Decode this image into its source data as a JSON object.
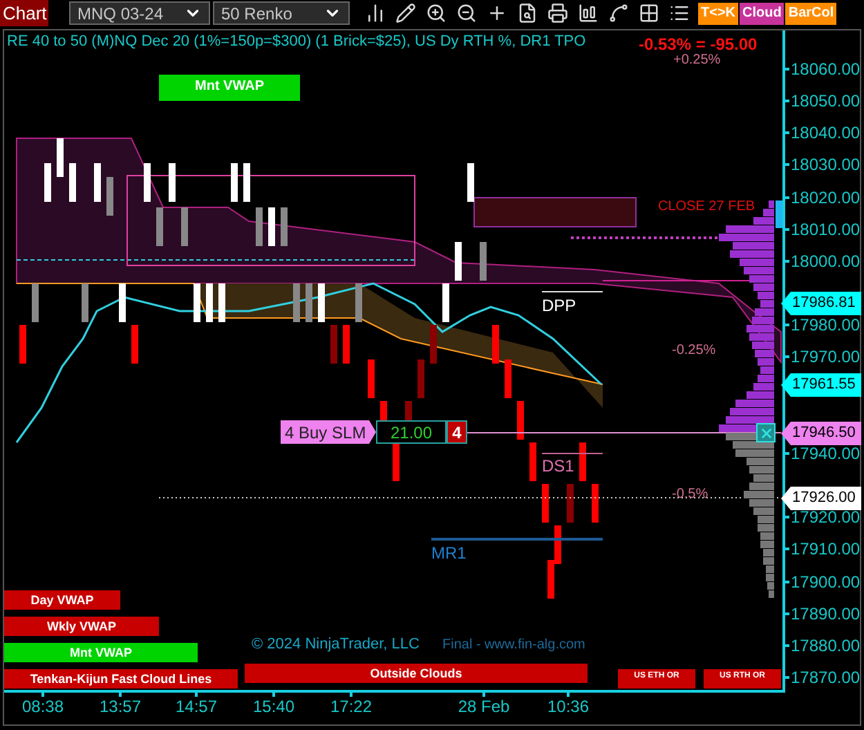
{
  "toolbar": {
    "title": "Chart",
    "instrument": "MNQ 03-24",
    "bar_type": "50 Renko",
    "buttons": [
      {
        "label": "T<>K",
        "color": "#ff8c00"
      },
      {
        "label": "Cloud",
        "color": "#c8329b"
      },
      {
        "label": "BarCol",
        "color": "#ff8c00"
      }
    ]
  },
  "chart": {
    "title": "RE 40 to 50 (M)NQ Dec 20 (1%=150p=$300) (1 Brick=$25), US Dy RTH %, DR1 TPO",
    "change": "-0.53% = -95.00",
    "labels": [
      {
        "text": "+0.25%",
        "kind": "percent"
      },
      {
        "text": "Mnt VWAP",
        "kind": "tag"
      },
      {
        "text": "CLOSE 27 FEB",
        "kind": "close"
      },
      {
        "text": "DPP",
        "kind": "pivot"
      },
      {
        "text": "-0.25%",
        "kind": "percent"
      },
      {
        "text": "DS1",
        "kind": "support"
      },
      {
        "text": "-0.5%",
        "kind": "percent"
      },
      {
        "text": "MR1",
        "kind": "mid"
      }
    ],
    "order": {
      "action": "4 Buy SLM",
      "price": "21.00",
      "quantity": "4"
    },
    "banners": [
      {
        "text": "Day VWAP",
        "color": "#c80000"
      },
      {
        "text": "Wkly VWAP",
        "color": "#c80000"
      },
      {
        "text": "Mnt VWAP",
        "color": "#00d400"
      },
      {
        "text": "Tenkan-Kijun Fast Cloud Lines",
        "color": "#c80000"
      },
      {
        "text": "Outside Clouds",
        "color": "#c80000"
      },
      {
        "text": "US ETH OR",
        "color": "#c80000"
      },
      {
        "text": "US RTH OR",
        "color": "#c80000"
      }
    ],
    "copyright": "© 2024 NinjaTrader, LLC",
    "credit": "Final - www.fin-alg.com"
  },
  "price_axis": {
    "labels": [
      "18060.00",
      "18050.00",
      "18040.00",
      "18030.00",
      "18020.00",
      "18010.00",
      "18000.00",
      "17980.00",
      "17970.00",
      "17940.00",
      "17920.00",
      "17910.00",
      "17900.00",
      "17890.00",
      "17880.00",
      "17870.00"
    ],
    "markers": [
      {
        "text": "17986.81",
        "color": "#00ffff"
      },
      {
        "text": "17961.55",
        "color": "#00ffff"
      },
      {
        "text": "17946.50",
        "color": "#ee82ee"
      },
      {
        "text": "17926.00",
        "color": "#ffffff"
      }
    ]
  },
  "time_axis": {
    "labels": [
      "08:38",
      "13:57",
      "14:57",
      "15:40",
      "17:22",
      "28 Feb",
      "10:36"
    ]
  }
}
